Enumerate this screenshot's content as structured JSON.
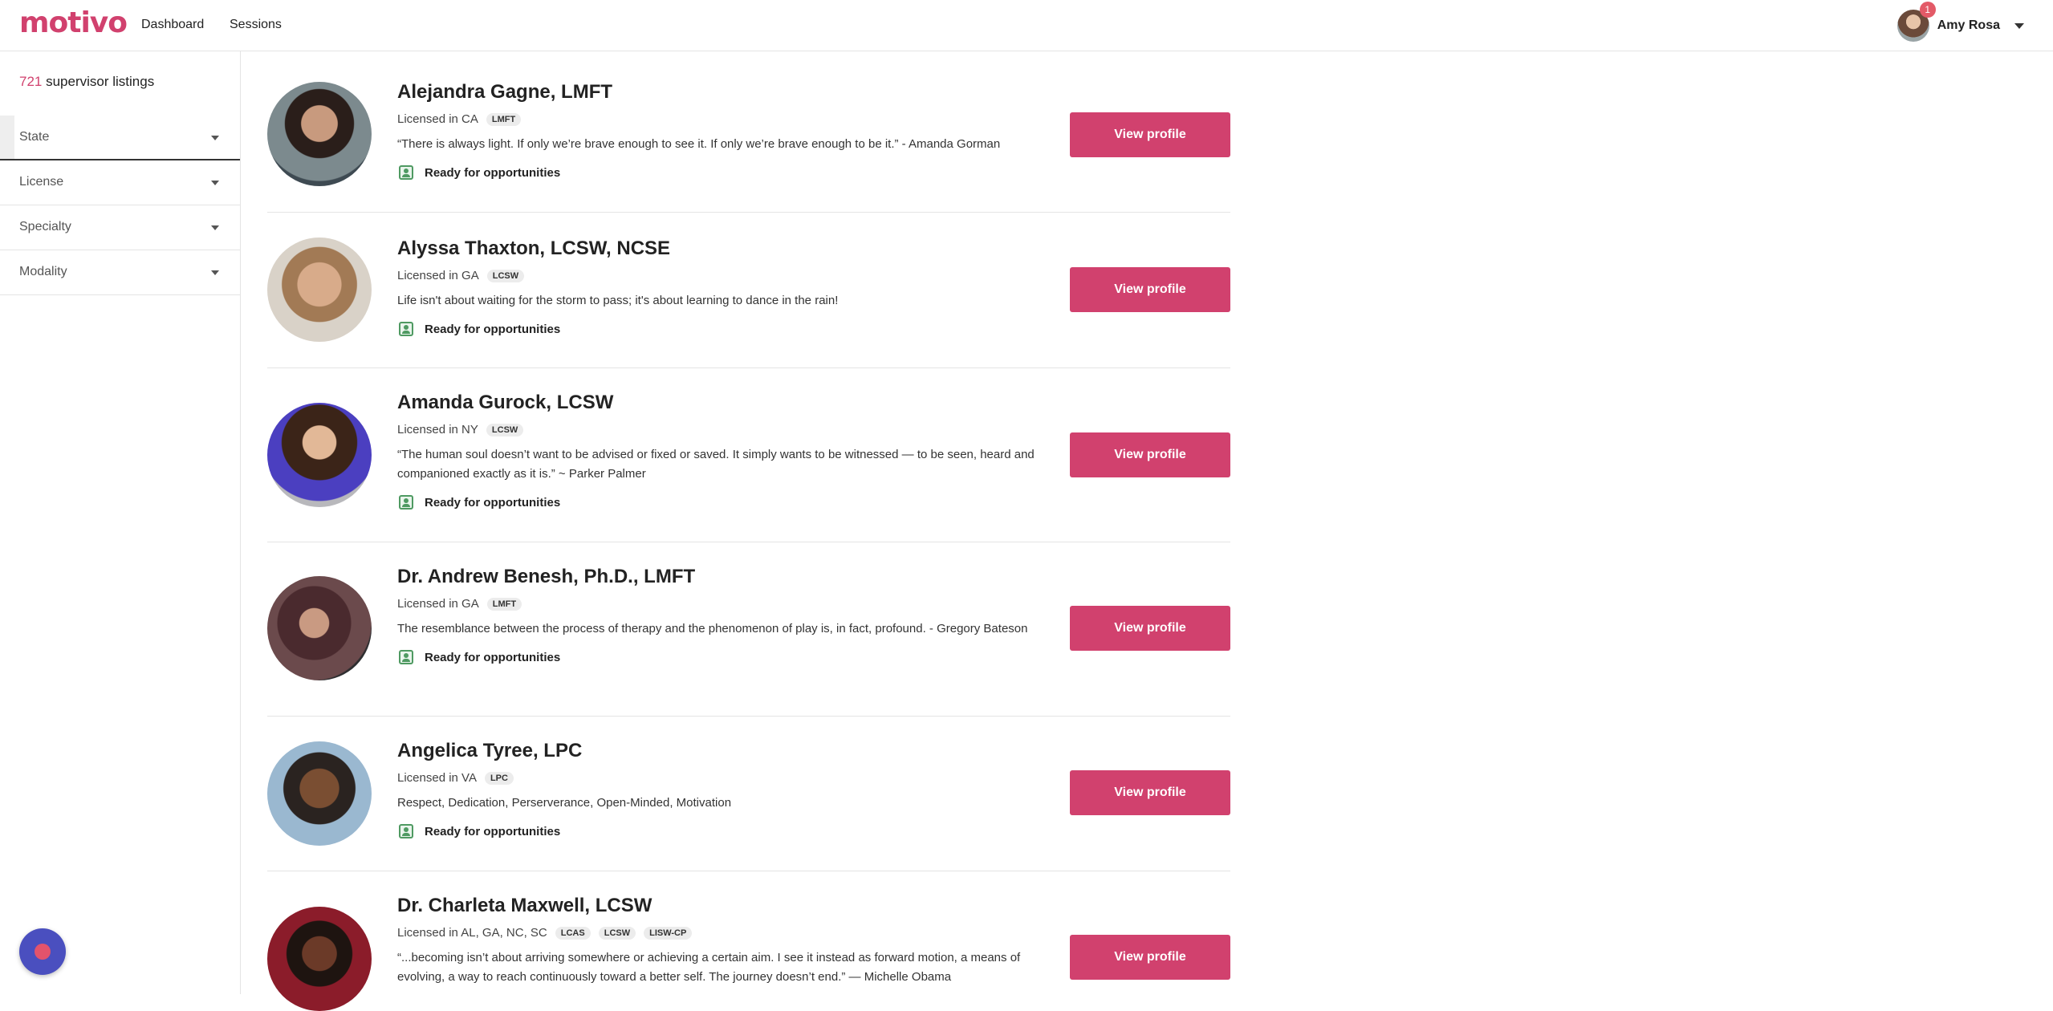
{
  "brand": {
    "logo_text": "motivo",
    "accent": "#d1416e"
  },
  "nav": {
    "dashboard": "Dashboard",
    "sessions": "Sessions"
  },
  "user": {
    "name": "Amy Rosa",
    "notifications": "1"
  },
  "sidebar": {
    "count": "721",
    "count_suffix": " supervisor listings",
    "filters": [
      "State",
      "License",
      "Specialty",
      "Modality"
    ]
  },
  "listings": [
    {
      "name": "Alejandra Gagne, LMFT",
      "licensed": "Licensed in CA",
      "badges": [
        "LMFT"
      ],
      "quote": "“There is always light. If only we’re brave enough to see it. If only we’re brave enough to be it.” - Amanda Gorman",
      "ready": "Ready for opportunities",
      "button": "View profile"
    },
    {
      "name": "Alyssa Thaxton, LCSW, NCSE",
      "licensed": "Licensed in GA",
      "badges": [
        "LCSW"
      ],
      "quote": "Life isn't about waiting for the storm to pass; it's about learning to dance in the rain!",
      "ready": "Ready for opportunities",
      "button": "View profile"
    },
    {
      "name": "Amanda Gurock, LCSW",
      "licensed": "Licensed in NY",
      "badges": [
        "LCSW"
      ],
      "quote": "“The human soul doesn’t want to be advised or fixed or saved. It simply wants to be witnessed — to be seen, heard and companioned exactly as it is.” ~ Parker Palmer",
      "ready": "Ready for opportunities",
      "button": "View profile"
    },
    {
      "name": "Dr. Andrew Benesh, Ph.D., LMFT",
      "licensed": "Licensed in GA",
      "badges": [
        "LMFT"
      ],
      "quote": "The resemblance between the process of therapy and the phenomenon of play is, in fact, profound. - Gregory Bateson",
      "ready": "Ready for opportunities",
      "button": "View profile"
    },
    {
      "name": "Angelica Tyree, LPC",
      "licensed": "Licensed in VA",
      "badges": [
        "LPC"
      ],
      "quote": "Respect, Dedication, Perserverance, Open-Minded, Motivation",
      "ready": "Ready for opportunities",
      "button": "View profile"
    },
    {
      "name": "Dr. Charleta Maxwell, LCSW",
      "licensed": "Licensed in AL, GA, NC, SC",
      "badges": [
        "LCAS",
        "LCSW",
        "LISW-CP"
      ],
      "quote": "“...becoming isn’t about arriving somewhere or achieving a certain aim. I see it instead as forward motion, a means of evolving, a way to reach continuously toward a better self. The journey doesn’t end.” — Michelle Obama",
      "ready": "",
      "button": "View profile"
    }
  ]
}
